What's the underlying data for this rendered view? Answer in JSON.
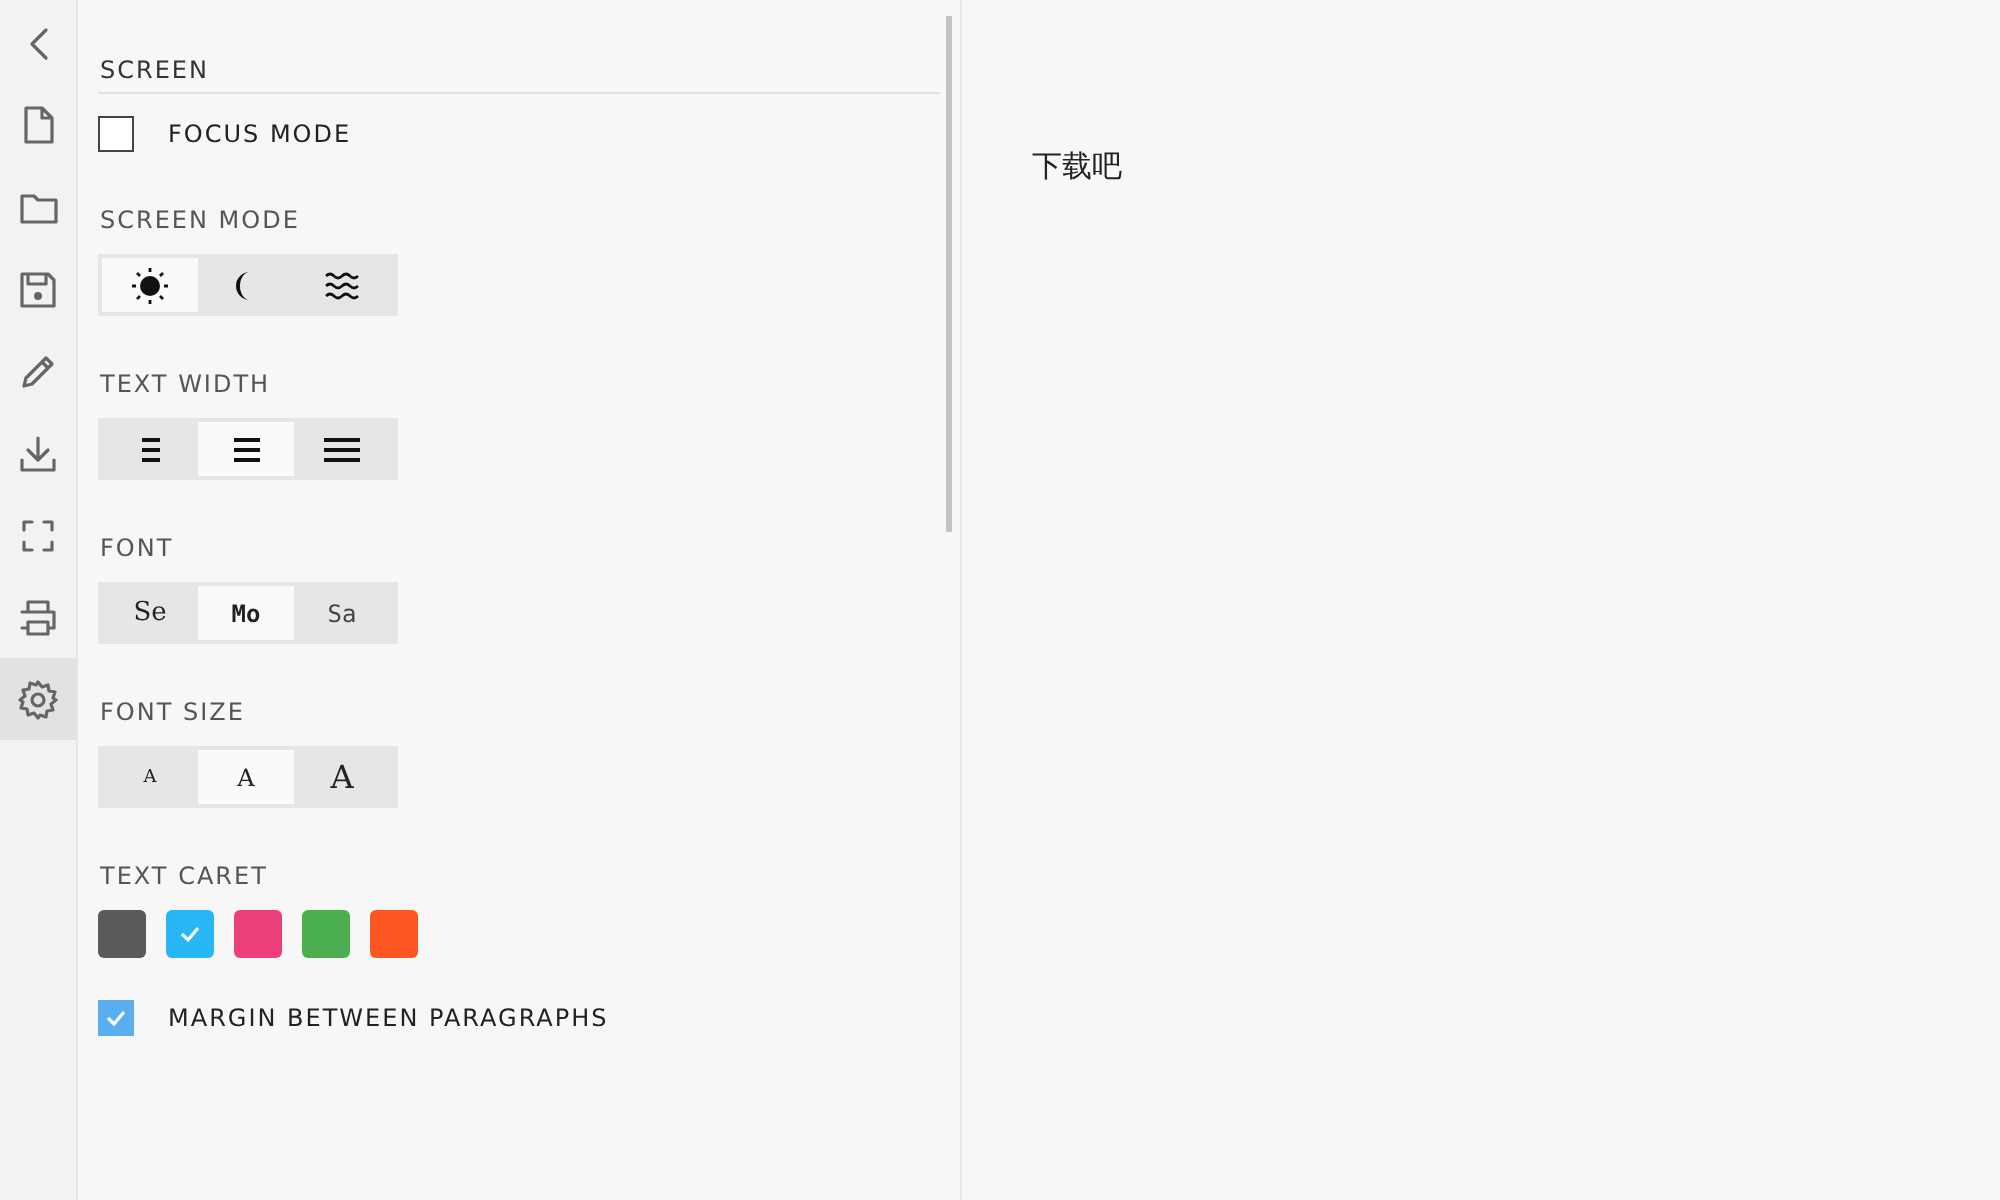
{
  "sidebar": {
    "items": [
      {
        "kind": "back",
        "selected": false
      },
      {
        "kind": "file",
        "selected": false
      },
      {
        "kind": "folder",
        "selected": false
      },
      {
        "kind": "save",
        "selected": false
      },
      {
        "kind": "pencil",
        "selected": false
      },
      {
        "kind": "download",
        "selected": false
      },
      {
        "kind": "fullscreen",
        "selected": false
      },
      {
        "kind": "print",
        "selected": false
      },
      {
        "kind": "gear",
        "selected": true
      }
    ]
  },
  "settings": {
    "title": "SCREEN",
    "sections": [
      {
        "kind": "checkbox",
        "label": "FOCUS MODE",
        "checked": false
      },
      {
        "kind": "segmented",
        "heading": "SCREEN MODE",
        "options": [
          {
            "kind": "sun",
            "selected": true
          },
          {
            "kind": "moon",
            "selected": false
          },
          {
            "kind": "waves",
            "selected": false
          }
        ]
      },
      {
        "kind": "segmented",
        "heading": "TEXT WIDTH",
        "options": [
          {
            "kind": "narrow",
            "selected": false
          },
          {
            "kind": "medium",
            "selected": true
          },
          {
            "kind": "wide",
            "selected": false
          }
        ]
      },
      {
        "kind": "segmented",
        "heading": "FONT",
        "options": [
          {
            "kind": "serif",
            "label": "Se",
            "selected": false
          },
          {
            "kind": "mono",
            "label": "Mo",
            "selected": true
          },
          {
            "kind": "sans",
            "label": "Sa",
            "selected": false
          }
        ]
      },
      {
        "kind": "segmented",
        "heading": "FONT SIZE",
        "options": [
          {
            "kind": "small",
            "label": "A",
            "selected": false
          },
          {
            "kind": "normal",
            "label": "A",
            "selected": true
          },
          {
            "kind": "large",
            "label": "A",
            "selected": false
          }
        ]
      },
      {
        "kind": "colors",
        "heading": "TEXT CARET",
        "swatches": [
          {
            "color": "#5a5a5a",
            "selected": false
          },
          {
            "color": "#29b6f6",
            "selected": true
          },
          {
            "color": "#ec407a",
            "selected": false
          },
          {
            "color": "#4caf50",
            "selected": false
          },
          {
            "color": "#ff5722",
            "selected": false
          }
        ]
      },
      {
        "kind": "checkbox",
        "label": "MARGIN BETWEEN PARAGRAPHS",
        "checked": true
      }
    ]
  },
  "editor": {
    "text": "下载吧"
  }
}
